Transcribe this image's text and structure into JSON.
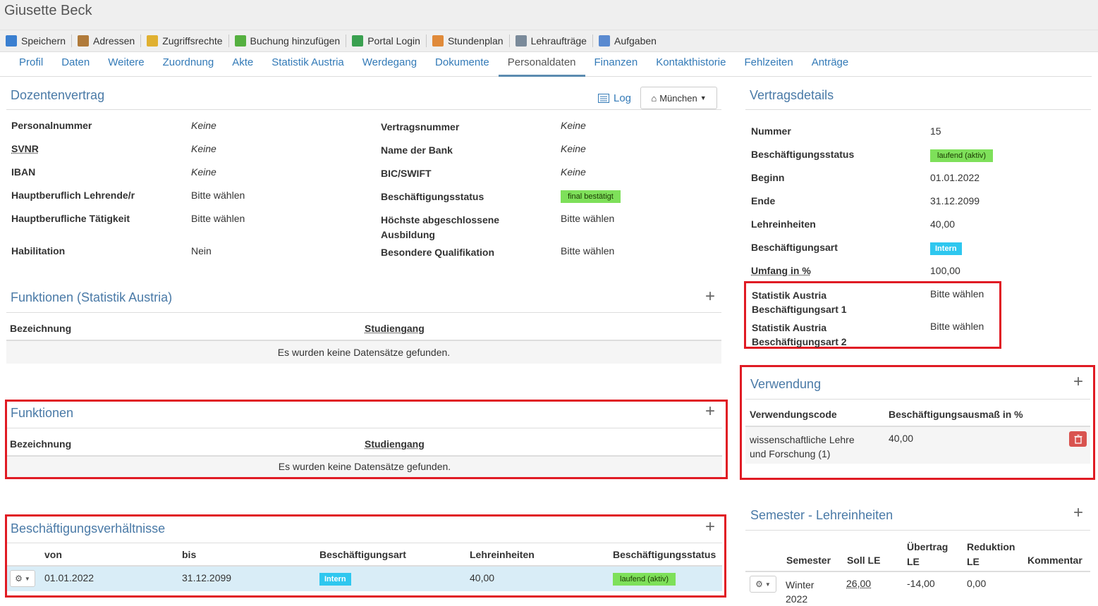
{
  "window": {
    "title": "Giusette Beck"
  },
  "toolbar": [
    {
      "label": "Speichern",
      "icon": "save-icon",
      "color": "#3a7fd0"
    },
    {
      "label": "Adressen",
      "icon": "address-book-icon",
      "color": "#b07a3a"
    },
    {
      "label": "Zugriffsrechte",
      "icon": "lock-icon",
      "color": "#e0b030"
    },
    {
      "label": "Buchung hinzufügen",
      "icon": "add-circle-icon",
      "color": "#55b040"
    },
    {
      "label": "Portal Login",
      "icon": "globe-icon",
      "color": "#3aa050"
    },
    {
      "label": "Stundenplan",
      "icon": "calendar-icon",
      "color": "#e08a3a"
    },
    {
      "label": "Lehraufträge",
      "icon": "car-icon",
      "color": "#7a8a9a"
    },
    {
      "label": "Aufgaben",
      "icon": "tasks-icon",
      "color": "#5a8ad0"
    }
  ],
  "tabs": [
    "Profil",
    "Daten",
    "Weitere",
    "Zuordnung",
    "Akte",
    "Statistik Austria",
    "Werdegang",
    "Dokumente",
    "Personaldaten",
    "Finanzen",
    "Kontakthistorie",
    "Fehlzeiten",
    "Anträge"
  ],
  "active_tab": "Personaldaten",
  "dozentenvertrag": {
    "title": "Dozentenvertrag",
    "log_label": "Log",
    "location_label": "München",
    "left": [
      {
        "label": "Personalnummer",
        "value": "Keine"
      },
      {
        "label": "SVNR",
        "value": "Keine"
      },
      {
        "label": "IBAN",
        "value": "Keine"
      },
      {
        "label": "Hauptberuflich Lehrende/r",
        "value": "Bitte wählen"
      },
      {
        "label": "Hauptberufliche Tätigkeit",
        "value": "Bitte wählen"
      },
      {
        "label": "Habilitation",
        "value": "Nein"
      }
    ],
    "right": [
      {
        "label": "Vertragsnummer",
        "value": "Keine"
      },
      {
        "label": "Name der Bank",
        "value": "Keine"
      },
      {
        "label": "BIC/SWIFT",
        "value": "Keine"
      },
      {
        "label": "Beschäftigungsstatus",
        "value": "final bestätigt"
      },
      {
        "label": "Höchste abgeschlossene",
        "label2": "Ausbildung",
        "value": "Bitte wählen"
      },
      {
        "label": "Besondere Qualifikation",
        "value": "Bitte wählen"
      }
    ]
  },
  "funktionen_statistik": {
    "title": "Funktionen (Statistik Austria)",
    "col1": "Bezeichnung",
    "col2": "Studiengang",
    "empty": "Es wurden keine Datensätze gefunden."
  },
  "funktionen": {
    "title": "Funktionen",
    "col1": "Bezeichnung",
    "col2": "Studiengang",
    "empty": "Es wurden keine Datensätze gefunden."
  },
  "beschaeftigung": {
    "title": "Beschäftigungsverhältnisse",
    "cols": [
      "von",
      "bis",
      "Beschäftigungsart",
      "Lehreinheiten",
      "Beschäftigungsstatus"
    ],
    "row": {
      "von": "01.01.2022",
      "bis": "31.12.2099",
      "art": "Intern",
      "le": "40,00",
      "status": "laufend (aktiv)"
    }
  },
  "vertragsdetails": {
    "title": "Vertragsdetails",
    "rows": [
      {
        "label": "Nummer",
        "value": "15"
      },
      {
        "label": "Beschäftigungsstatus",
        "value": "laufend (aktiv)"
      },
      {
        "label": "Beginn",
        "value": "01.01.2022"
      },
      {
        "label": "Ende",
        "value": "31.12.2099"
      },
      {
        "label": "Lehreinheiten",
        "value": "40,00"
      },
      {
        "label": "Beschäftigungsart",
        "value": "Intern"
      },
      {
        "label": "Umfang in %",
        "value": "100,00"
      }
    ],
    "stat1_label1": "Statistik Austria",
    "stat1_label2": "Beschäftigungsart 1",
    "stat1_value": "Bitte wählen",
    "stat2_label1": "Statistik Austria",
    "stat2_label2": "Beschäftigungsart 2",
    "stat2_value": "Bitte wählen"
  },
  "verwendung": {
    "title": "Verwendung",
    "col1": "Verwendungscode",
    "col2": "Beschäftigungsausmaß in %",
    "row_code1": "wissenschaftliche Lehre",
    "row_code2": "und Forschung (1)",
    "row_value": "40,00"
  },
  "semester": {
    "title": "Semester - Lehreinheiten",
    "cols": {
      "semester": "Semester",
      "soll": "Soll LE",
      "uebertrag1": "Übertrag",
      "uebertrag2": "LE",
      "reduktion1": "Reduktion",
      "reduktion2": "LE",
      "kommentar": "Kommentar"
    },
    "row": {
      "semester1": "Winter",
      "semester2": "2022",
      "soll": "26,00",
      "uebertrag": "-14,00",
      "reduktion": "0,00"
    }
  },
  "colors": {
    "accent": "#337ab7",
    "highlight_box": "#e01b24",
    "status_green": "#7ee05a",
    "badge_cyan": "#2ec7ef"
  }
}
